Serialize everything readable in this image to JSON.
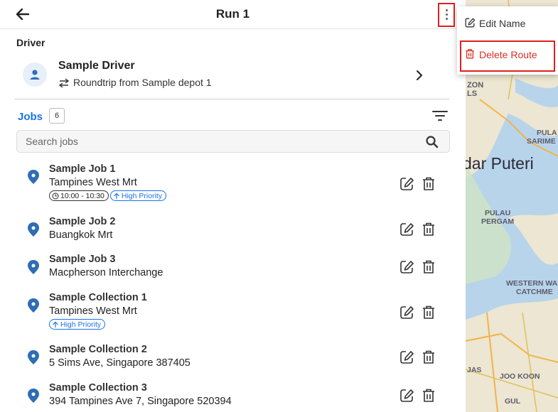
{
  "header": {
    "title": "Run 1"
  },
  "driver": {
    "section_label": "Driver",
    "name": "Sample Driver",
    "route": "Roundtrip from Sample depot 1"
  },
  "jobs": {
    "label": "Jobs",
    "count": "6",
    "search_placeholder": "Search jobs",
    "items": [
      {
        "name": "Sample Job 1",
        "address": "Tampines West Mrt",
        "time": "10:00 - 10:30",
        "priority": "High Priority"
      },
      {
        "name": "Sample Job 2",
        "address": "Buangkok Mrt"
      },
      {
        "name": "Sample Job 3",
        "address": "Macpherson Interchange"
      },
      {
        "name": "Sample Collection 1",
        "address": "Tampines West Mrt",
        "priority": "High Priority"
      },
      {
        "name": "Sample Collection 2",
        "address": "5 Sims Ave, Singapore 387405"
      },
      {
        "name": "Sample Collection 3",
        "address": "394 Tampines Ave 7, Singapore 520394"
      }
    ]
  },
  "menu": {
    "edit_label": "Edit Name",
    "delete_label": "Delete Route"
  },
  "map": {
    "labels": [
      "ZON",
      "LS",
      "PULA",
      "SARIME",
      "dar Puteri",
      "PULAU",
      "PERGAM",
      "WESTERN WA",
      "CATCHME",
      "JAS",
      "JOO KOON",
      "GUL"
    ]
  },
  "colors": {
    "accent": "#1a73e8",
    "danger": "#d93025",
    "highlight": "#e02020",
    "pin": "#2f6db5"
  }
}
